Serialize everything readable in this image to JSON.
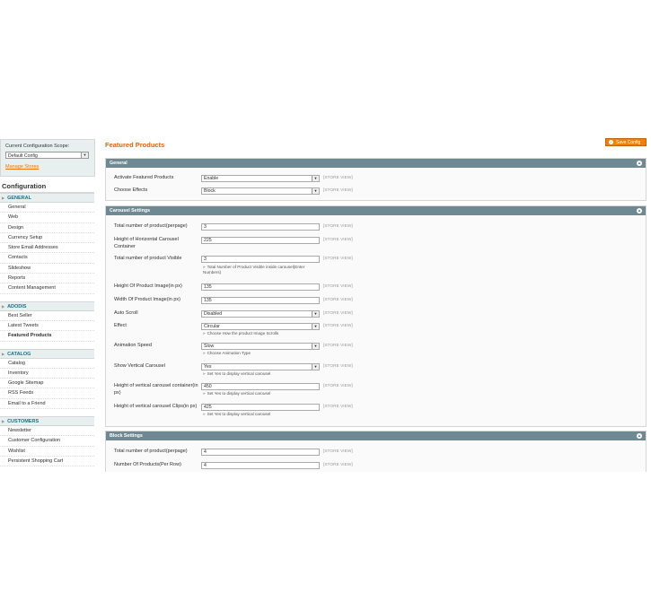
{
  "sidebar": {
    "scope_label": "Current Configuration Scope:",
    "scope_value": "Default Config",
    "manage_stores": "Manage Stores",
    "title": "Configuration",
    "groups": [
      {
        "label": "GENERAL",
        "items": [
          "General",
          "Web",
          "Design",
          "Currency Setup",
          "Store Email Addresses",
          "Contacts",
          "Slideshow",
          "Reports",
          "Content Management"
        ]
      },
      {
        "label": "ADODIS",
        "items": [
          "Best Seller",
          "Latest Tweets",
          "Featured Products"
        ]
      },
      {
        "label": "CATALOG",
        "items": [
          "Catalog",
          "Inventory",
          "Google Sitemap",
          "RSS Feeds",
          "Email to a Friend"
        ]
      },
      {
        "label": "CUSTOMERS",
        "items": [
          "Newsletter",
          "Customer Configuration",
          "Wishlist",
          "Persistent Shopping Cart"
        ]
      }
    ],
    "active_item": "Featured Products"
  },
  "page_title": "Featured Products",
  "save_button": "Save Config",
  "store_view": "[STORE VIEW]",
  "sections": {
    "general": {
      "title": "General",
      "rows": [
        {
          "label": "Activate Featured Products",
          "value": "Enable"
        },
        {
          "label": "Choose Effects",
          "value": "Block"
        }
      ]
    },
    "carousel": {
      "title": "Carousel Settings",
      "rows": [
        {
          "label": "Total number of product(perpage)",
          "value": "3"
        },
        {
          "label": "Height of Horizontal Carousel Container",
          "value": "225"
        },
        {
          "label": "Total number of product Visible",
          "value": "3",
          "note": "Total Number of Product Visible inside carousel(Enter Numbers)"
        },
        {
          "label": "Height Of Product Image(in px)",
          "value": "135"
        },
        {
          "label": "Width Of Product Image(in px)",
          "value": "135"
        },
        {
          "label": "Auto Scroll",
          "value": "Disabled"
        },
        {
          "label": "Effect",
          "value": "Circular",
          "note": "Choose How the product Image Scrolls"
        },
        {
          "label": "Animation Speed",
          "value": "Slow",
          "note": "Choose Animation Type"
        },
        {
          "label": "Show Vertical Carousel",
          "value": "Yes",
          "note": "Set Yes to display vertical carousel"
        },
        {
          "label": "Height of vertical carousel container(in px)",
          "value": "450",
          "note": "Set Yes to display vertical carousel"
        },
        {
          "label": "Height of vertical carousel Clips(in px)",
          "value": "425",
          "note": "Set Yes to display vertical carousel"
        }
      ]
    },
    "block": {
      "title": "Block Settings",
      "rows": [
        {
          "label": "Total number of product(perpage)",
          "value": "4"
        },
        {
          "label": "Number Of Products(Per Row)",
          "value": "4"
        }
      ]
    }
  }
}
